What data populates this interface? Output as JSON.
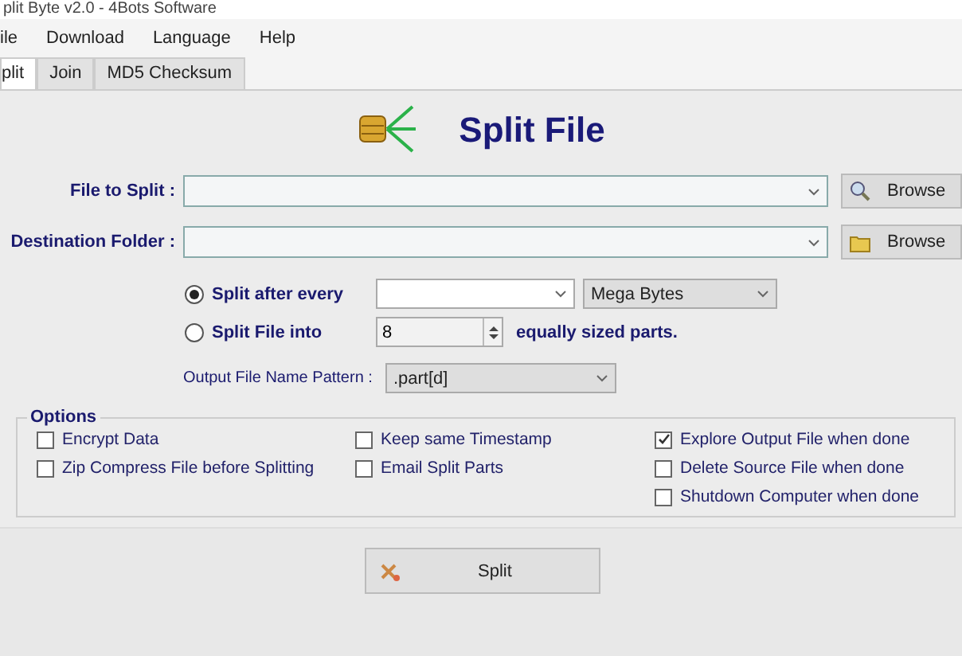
{
  "window": {
    "title": "plit Byte v2.0 - 4Bots Software"
  },
  "menu": [
    "ile",
    "Download",
    "Language",
    "Help"
  ],
  "tabs": [
    {
      "label": "plit",
      "selected": true
    },
    {
      "label": "Join",
      "selected": false
    },
    {
      "label": "MD5 Checksum",
      "selected": false
    }
  ],
  "heading": "Split File",
  "path_fields": [
    {
      "label": "File to Split :",
      "button": "Browse",
      "kind": "file"
    },
    {
      "label": "Destination Folder :",
      "button": "Browse",
      "kind": "folder"
    }
  ],
  "split_modes": [
    {
      "label": "Split after every",
      "selected": true,
      "kind": "size",
      "unit": "Mega Bytes"
    },
    {
      "label": "Split File into",
      "selected": false,
      "kind": "count",
      "value": "8",
      "suffix": "equally sized parts."
    }
  ],
  "pattern": {
    "label": "Output File Name Pattern :",
    "value": ".part[d]"
  },
  "options": {
    "title": "Options",
    "columns": [
      [
        {
          "label": "Encrypt Data",
          "checked": false
        },
        {
          "label": "Zip Compress File before Splitting",
          "checked": false
        }
      ],
      [
        {
          "label": "Keep same Timestamp",
          "checked": false
        },
        {
          "label": "Email Split Parts",
          "checked": false
        }
      ],
      [
        {
          "label": "Explore Output File when done",
          "checked": true
        },
        {
          "label": "Delete Source File when done",
          "checked": false
        },
        {
          "label": "Shutdown Computer when done",
          "checked": false
        }
      ]
    ]
  },
  "action_button": "Split"
}
